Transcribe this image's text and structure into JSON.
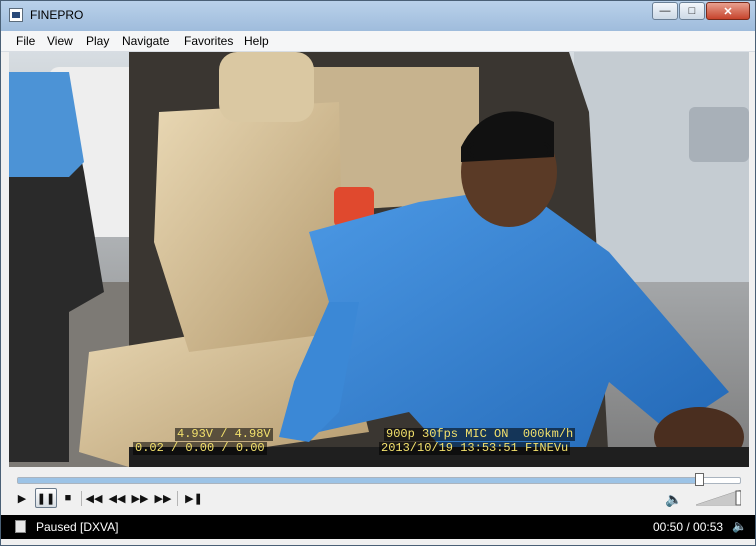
{
  "window": {
    "title": "FINEPRO"
  },
  "menu": [
    "File",
    "View",
    "Play",
    "Navigate",
    "Favorites",
    "Help"
  ],
  "video": {
    "osd_voltage": "4.93V / 4.98V",
    "osd_gsensor": "0.02 / 0.00 / 0.00",
    "osd_info": "900p 30fps MIC ON  000km/h",
    "osd_datetime": "2013/10/19 13:53:51 FINEVu"
  },
  "playback": {
    "position_fraction": 0.943,
    "volume_fraction": 1.0
  },
  "icons": {
    "play": "play-icon",
    "pause": "pause-icon",
    "stop": "stop-icon",
    "skip_back": "skip-back-icon",
    "rewind": "rewind-icon",
    "forward": "fast-forward-icon",
    "skip_forward": "skip-forward-icon",
    "frame_step": "frame-step-icon",
    "volume": "speaker-icon"
  },
  "status": {
    "text": "Paused [DXVA]",
    "time": "00:50 / 00:53"
  },
  "colors": {
    "osd_text": "#f3e16c",
    "shirt": "#3a86d4",
    "statusbar": "#000000"
  }
}
